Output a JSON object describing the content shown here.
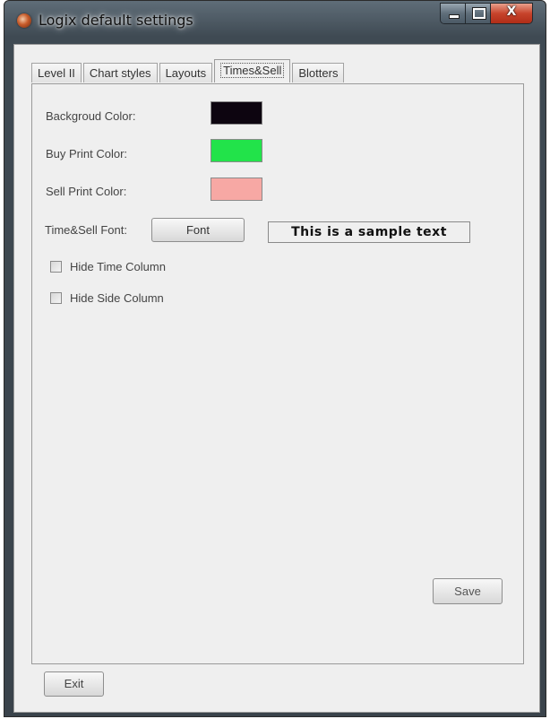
{
  "window": {
    "title": "Logix default settings",
    "app_icon": "logix-app-icon",
    "caption_icons": [
      "minimize-icon",
      "maximize-icon",
      "close-icon"
    ],
    "close_glyph": "X"
  },
  "tabs": [
    {
      "label": "Level II",
      "active": false
    },
    {
      "label": "Chart styles",
      "active": false
    },
    {
      "label": "Layouts",
      "active": false
    },
    {
      "label": "Times&Sell",
      "active": true
    },
    {
      "label": "Blotters",
      "active": false
    }
  ],
  "settings": {
    "background_color": {
      "label": "Backgroud Color:",
      "color": "#0d0510"
    },
    "buy_print_color": {
      "label": "Buy Print Color:",
      "color": "#22e34a"
    },
    "sell_print_color": {
      "label": "Sell Print Color:",
      "color": "#f7a8a4"
    },
    "font": {
      "label": "Time&Sell Font:",
      "button_label": "Font",
      "sample_text": "This is a sample text"
    },
    "hide_time_column": {
      "label": "Hide Time Column",
      "checked": false
    },
    "hide_side_column": {
      "label": "Hide Side Column",
      "checked": false
    }
  },
  "buttons": {
    "save_label": "Save",
    "exit_label": "Exit"
  }
}
